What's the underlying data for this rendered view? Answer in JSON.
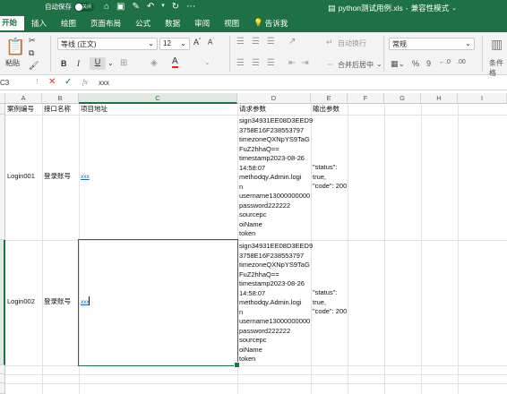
{
  "titlebar": {
    "autosave_label": "自动保存",
    "autosave_state": "关闭",
    "filename": "python测试用例.xls",
    "mode": "兼容性模式",
    "mode_sep": " - "
  },
  "tabs": [
    "开始",
    "插入",
    "绘图",
    "页面布局",
    "公式",
    "数据",
    "审阅",
    "视图"
  ],
  "tell_me": "告诉我",
  "ribbon": {
    "paste_label": "粘贴",
    "font_name": "等线 (正文)",
    "font_size": "12",
    "wrap_text": "自动换行",
    "merge_center": "合并后居中",
    "number_format": "常规",
    "conditional_format": "条件格"
  },
  "formula_bar": {
    "name_box": "C3",
    "fx": "fx",
    "content": "xxx"
  },
  "columns": [
    "A",
    "B",
    "C",
    "D",
    "E",
    "F",
    "G",
    "H",
    "I"
  ],
  "header_row": {
    "a": "案例编号",
    "b": "接口名称",
    "c": "项目地址",
    "d": "请求参数",
    "e": "输出参数"
  },
  "rows": [
    {
      "id": "Login001",
      "name": "登录账号",
      "url": "xxx",
      "params": [
        "sign34931EE08D3EED9",
        "3758E16F238553797",
        "timezoneQXNpYS9TaG",
        "FuZ2hhaQ==",
        "timestamp2023-08-26",
        "14:58:07",
        "methodqy.Admin.logi",
        "n",
        "username13000000000",
        "password222222",
        "sourcepc",
        "oiName",
        "token"
      ],
      "output": [
        "\"status\":",
        "true,",
        "\"code\": 200"
      ]
    },
    {
      "id": "Login002",
      "name": "登录账号",
      "url": "xxx",
      "params": [
        "sign34931EE08D3EED9",
        "3758E16F238553797",
        "timezoneQXNpYS9TaG",
        "FuZ2hhaQ==",
        "timestamp2023-08-26",
        "14:58:07",
        "methodqy.Admin.logi",
        "n",
        "username13000000000",
        "password222222",
        "sourcepc",
        "oiName",
        "token"
      ],
      "output": [
        "\"status\":",
        "true,",
        "\"code\": 200"
      ]
    }
  ],
  "colors": {
    "brand": "#1e7145",
    "link": "#1f5fbf"
  }
}
